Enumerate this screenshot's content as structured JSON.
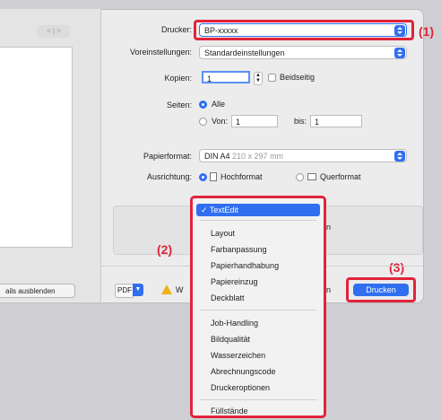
{
  "sidebar": {
    "pager_label": "< | >",
    "details_button": "ails ausblenden"
  },
  "printer": {
    "label": "Drucker:",
    "value": "BP-xxxxx"
  },
  "presets": {
    "label": "Voreinstellungen:",
    "value": "Standardeinstellungen"
  },
  "copies": {
    "label": "Kopien:",
    "value": "1",
    "duplex_label": "Beidseitig"
  },
  "pages": {
    "label": "Seiten:",
    "all_label": "Alle",
    "from_label": "Von:",
    "from_value": "1",
    "to_label": "bis:",
    "to_value": "1"
  },
  "paper": {
    "label": "Papierformat:",
    "value": "DIN A4",
    "size": "210 x 297 mm"
  },
  "orientation": {
    "label": "Ausrichtung:",
    "portrait": "Hochformat",
    "landscape": "Querformat"
  },
  "menu": {
    "selected": "✓ TextEdit",
    "group1": [
      "Layout",
      "Farbanpassung",
      "Papierhandhabung",
      "Papiereinzug",
      "Deckblatt"
    ],
    "group2": [
      "Job-Handling",
      "Bildqualität",
      "Wasserzeichen",
      "Abrechnungscode",
      "Druckeroptionen"
    ],
    "group3": [
      "Füllstände"
    ]
  },
  "box_area_partial": "n",
  "footer": {
    "pdf": "PDF",
    "warn_partial": "W",
    "cancel_partial": "n",
    "print": "Drucken"
  },
  "callouts": {
    "c1": "(1)",
    "c2": "(2)",
    "c3": "(3)"
  },
  "colors": {
    "accent": "#2f6ff0",
    "highlight": "#e0243a"
  }
}
